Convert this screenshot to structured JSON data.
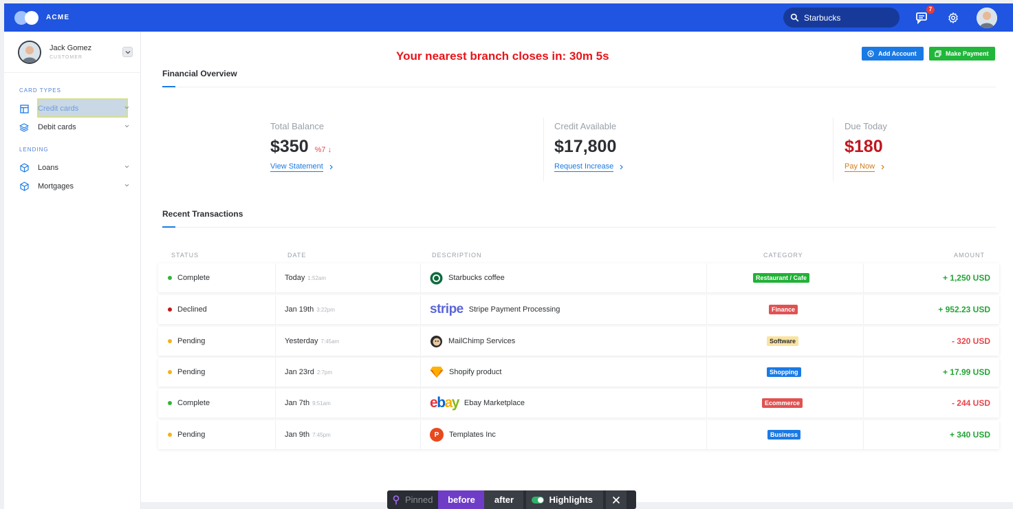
{
  "brand": {
    "name": "ACME"
  },
  "search": {
    "value": "Starbucks"
  },
  "notifications": {
    "count": "7"
  },
  "user": {
    "name": "Jack Gomez",
    "role": "CUSTOMER"
  },
  "sidebar": {
    "sections": [
      {
        "title": "CARD TYPES",
        "items": [
          {
            "label": "Credit cards"
          },
          {
            "label": "Debit cards"
          }
        ]
      },
      {
        "title": "LENDING",
        "items": [
          {
            "label": "Loans"
          },
          {
            "label": "Mortgages"
          }
        ]
      }
    ]
  },
  "header": {
    "countdown": "Your nearest branch closes in: 30m 5s",
    "add_account": "Add Account",
    "make_payment": "Make Payment"
  },
  "overview": {
    "title": "Financial Overview",
    "stats": [
      {
        "label": "Total Balance",
        "value": "$350",
        "delta": "%7",
        "link": "View Statement"
      },
      {
        "label": "Credit Available",
        "value": "$17,800",
        "link": "Request Increase"
      },
      {
        "label": "Due Today",
        "value": "$180",
        "link": "Pay Now"
      }
    ]
  },
  "transactions": {
    "title": "Recent Transactions",
    "columns": [
      "STATUS",
      "DATE",
      "DESCRIPTION",
      "CATEGORY",
      "AMOUNT"
    ],
    "rows": [
      {
        "status": "Complete",
        "date": "Today",
        "time": "1:52am",
        "description": "Starbucks coffee",
        "category": "Restaurant / Cafe",
        "amount": "+ 1,250 USD"
      },
      {
        "status": "Declined",
        "date": "Jan 19th",
        "time": "3:22pm",
        "description": "Stripe Payment Processing",
        "category": "Finance",
        "amount": "+ 952.23 USD"
      },
      {
        "status": "Pending",
        "date": "Yesterday",
        "time": "7:45am",
        "description": "MailChimp Services",
        "category": "Software",
        "amount": "- 320 USD"
      },
      {
        "status": "Pending",
        "date": "Jan 23rd",
        "time": "2:7pm",
        "description": "Shopify product",
        "category": "Shopping",
        "amount": "+ 17.99 USD"
      },
      {
        "status": "Complete",
        "date": "Jan 7th",
        "time": "9:51am",
        "description": "Ebay Marketplace",
        "category": "Ecommerce",
        "amount": "- 244 USD"
      },
      {
        "status": "Pending",
        "date": "Jan 9th",
        "time": "7:45pm",
        "description": "Templates Inc",
        "category": "Business",
        "amount": "+ 340 USD"
      }
    ]
  },
  "logos": {
    "stripe": "stripe",
    "ebay_e": "e",
    "ebay_b": "b",
    "ebay_a": "a",
    "ebay_y": "y",
    "templates": "P"
  },
  "toolbar": {
    "pinned": "Pinned",
    "before": "before",
    "after": "after",
    "highlights": "Highlights"
  }
}
